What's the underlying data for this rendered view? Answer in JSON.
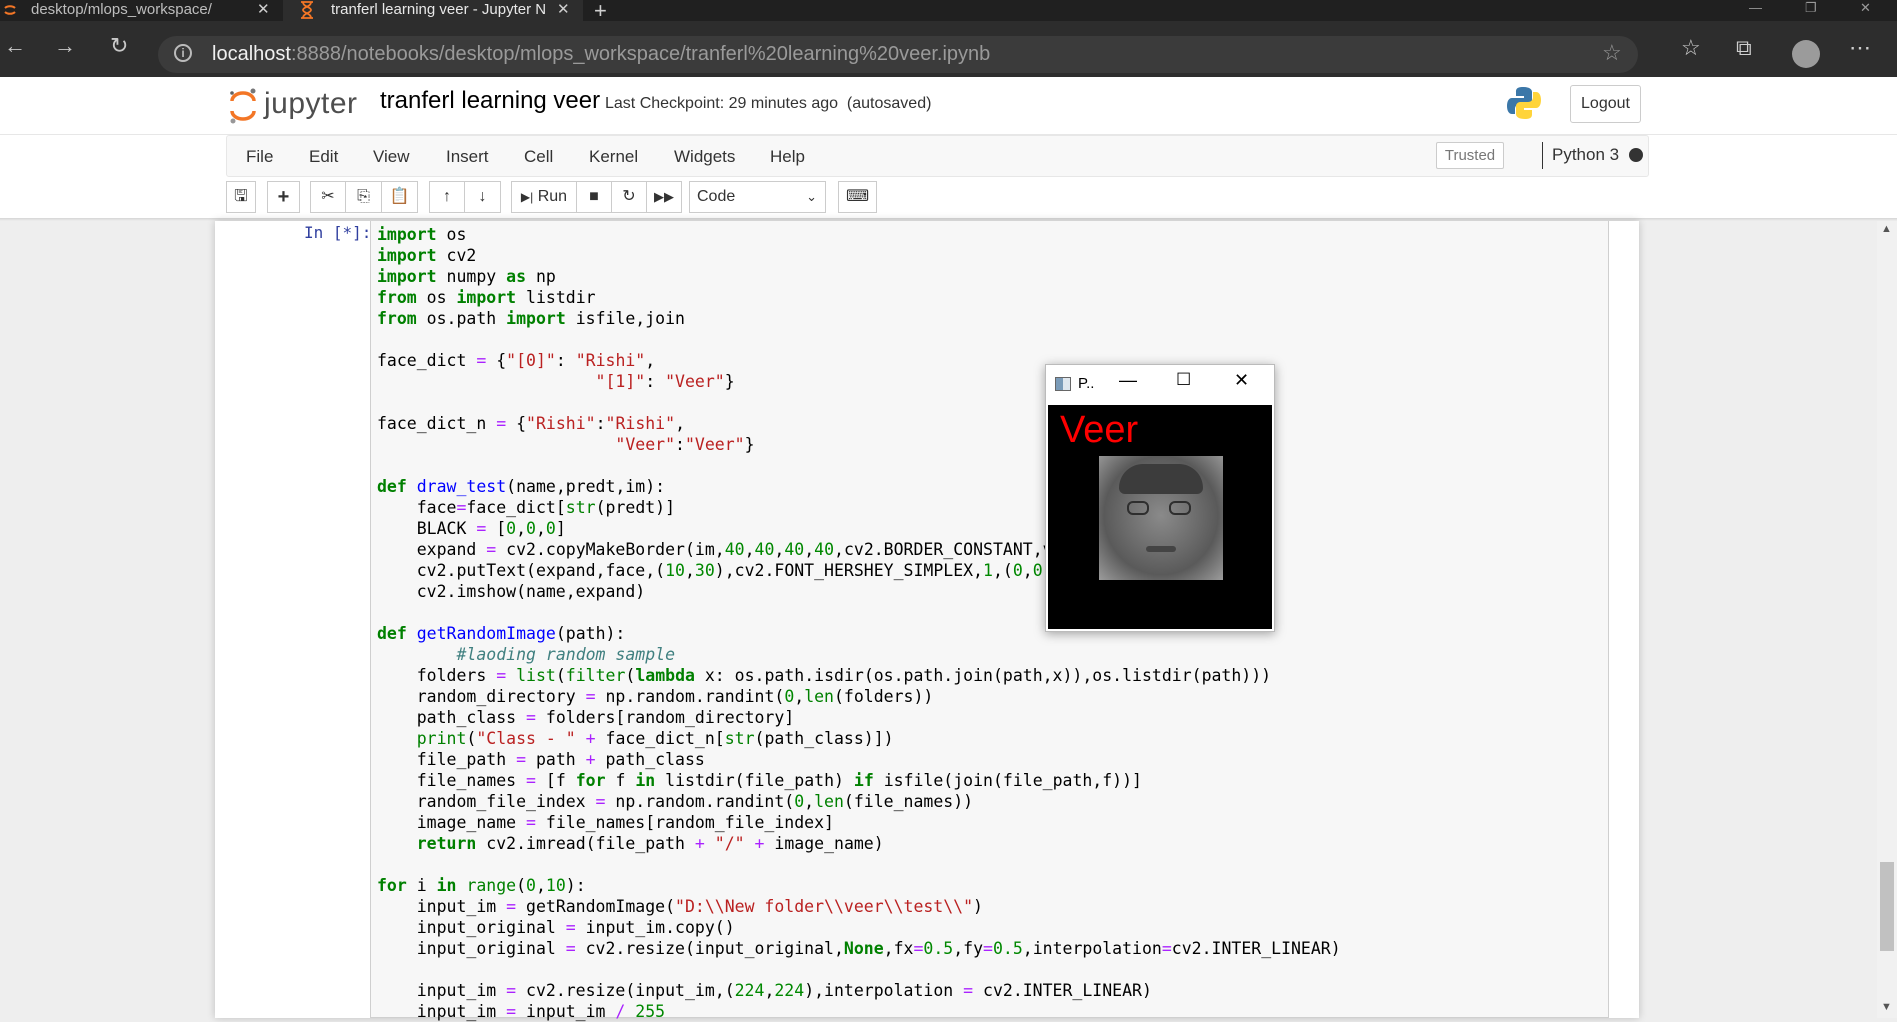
{
  "browser": {
    "tabs": [
      {
        "title": "desktop/mlops_workspace/",
        "close": "✕"
      },
      {
        "title": "tranferl learning veer - Jupyter N",
        "close": "✕"
      }
    ],
    "new_tab": "+",
    "url_host": "localhost",
    "url_rest": ":8888/notebooks/desktop/mlops_workspace/tranferl%20learning%20veer.ipynb"
  },
  "jupyter": {
    "logo_text": "jupyter",
    "notebook_title": "tranferl learning veer",
    "checkpoint": "Last Checkpoint: 29 minutes ago",
    "autosaved": "(autosaved)",
    "logout": "Logout",
    "menu": [
      "File",
      "Edit",
      "View",
      "Insert",
      "Cell",
      "Kernel",
      "Widgets",
      "Help"
    ],
    "trusted": "Trusted",
    "kernel": "Python 3",
    "run_label": "Run",
    "cell_type": "Code"
  },
  "cell": {
    "prompt": "In [*]:"
  },
  "cv_window": {
    "title": "P..",
    "label": "Veer",
    "label_color": "#ff0000"
  },
  "colors": {
    "keyword": "#008000",
    "string": "#ba2121",
    "prompt": "#303f9f",
    "comment": "#408080"
  }
}
